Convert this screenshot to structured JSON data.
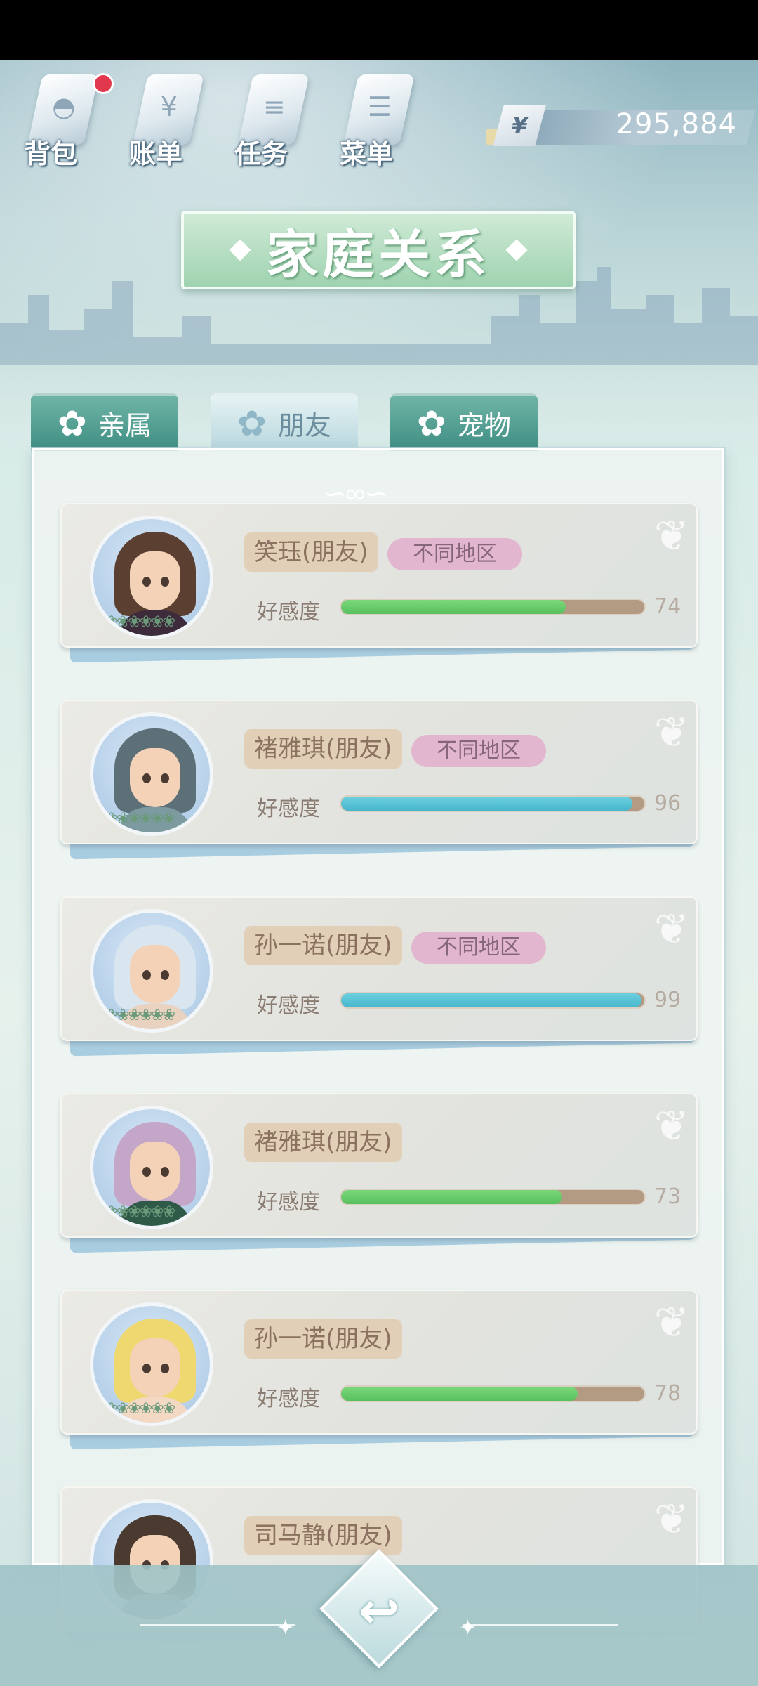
{
  "topnav": [
    {
      "label": "背包",
      "icon": "bag-icon",
      "badge": true
    },
    {
      "label": "账单",
      "icon": "bill-icon",
      "badge": false
    },
    {
      "label": "任务",
      "icon": "task-icon",
      "badge": false
    },
    {
      "label": "菜单",
      "icon": "menu-icon",
      "badge": false
    }
  ],
  "currency": {
    "symbol": "¥",
    "amount": "295,884"
  },
  "title": "家庭关系",
  "tabs": [
    {
      "label": "亲属",
      "active": false
    },
    {
      "label": "朋友",
      "active": true
    },
    {
      "label": "宠物",
      "active": false
    }
  ],
  "favor_label": "好感度",
  "people": [
    {
      "name": "笑珏(朋友)",
      "region": "不同地区",
      "favor": 74,
      "favor_text": "74",
      "bar_color": "green"
    },
    {
      "name": "褚雅琪(朋友)",
      "region": "不同地区",
      "favor": 96,
      "favor_text": "96",
      "bar_color": "blue"
    },
    {
      "name": "孙一诺(朋友)",
      "region": "不同地区",
      "favor": 99,
      "favor_text": "99",
      "bar_color": "blue"
    },
    {
      "name": "褚雅琪(朋友)",
      "region": "",
      "favor": 73,
      "favor_text": "73",
      "bar_color": "green"
    },
    {
      "name": "孙一诺(朋友)",
      "region": "",
      "favor": 78,
      "favor_text": "78",
      "bar_color": "green"
    },
    {
      "name": "司马静(朋友)",
      "region": "",
      "favor": null,
      "favor_text": "",
      "bar_color": "green"
    }
  ],
  "colors": {
    "accent": "#9fd3b0",
    "badge": "#e2384d",
    "favor_green": "#58c05e",
    "favor_blue": "#48b6cc",
    "region_pink": "#e2b6cf"
  }
}
